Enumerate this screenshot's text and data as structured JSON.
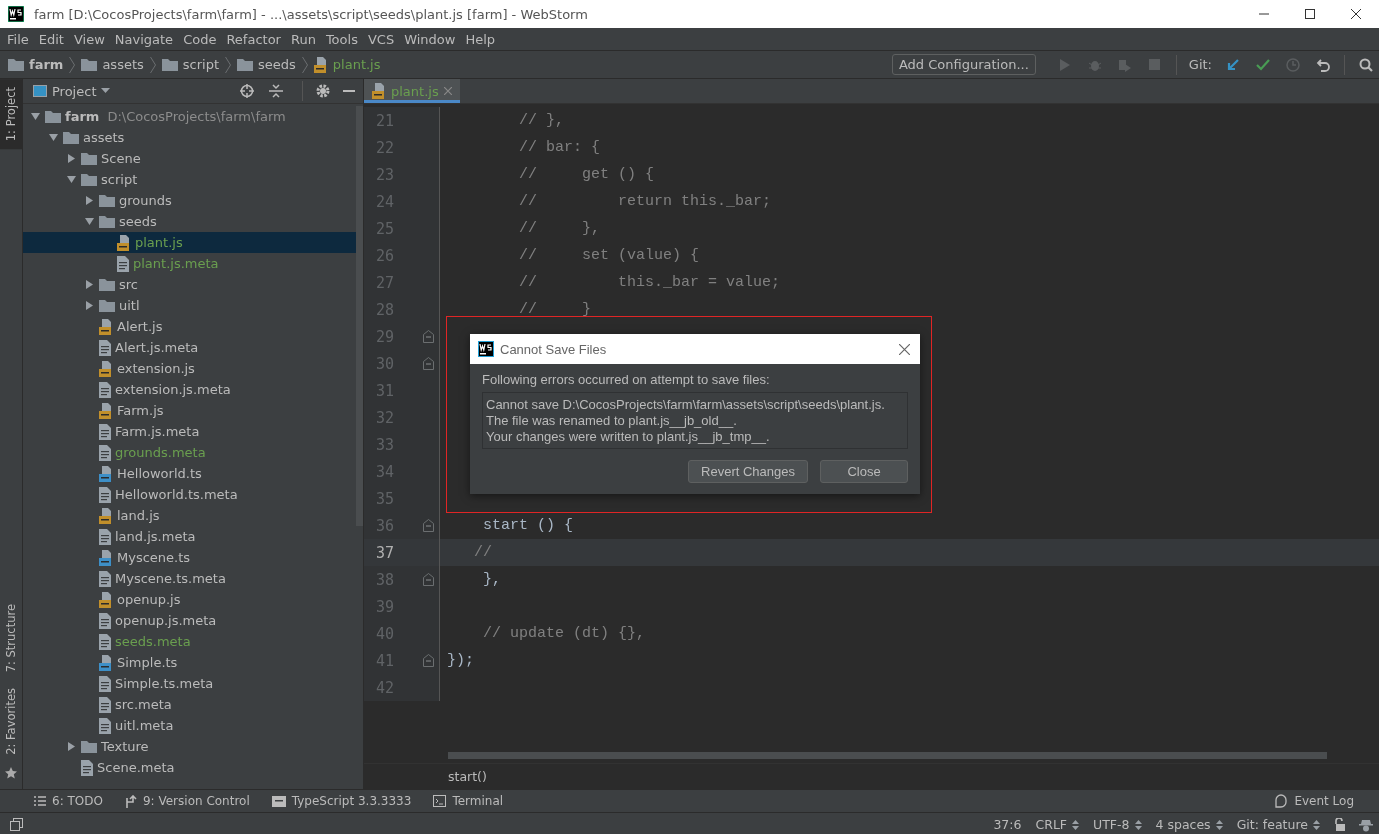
{
  "window": {
    "title": "farm [D:\\CocosProjects\\farm\\farm] - ...\\assets\\script\\seeds\\plant.js [farm] - WebStorm"
  },
  "menu": [
    "File",
    "Edit",
    "View",
    "Navigate",
    "Code",
    "Refactor",
    "Run",
    "Tools",
    "VCS",
    "Window",
    "Help"
  ],
  "breadcrumbs": [
    {
      "label": "farm",
      "kind": "root"
    },
    {
      "label": "assets",
      "kind": "folder"
    },
    {
      "label": "script",
      "kind": "folder"
    },
    {
      "label": "seeds",
      "kind": "folder"
    },
    {
      "label": "plant.js",
      "kind": "js"
    }
  ],
  "toolbar": {
    "configuration": "Add Configuration...",
    "vcs_label": "Git:"
  },
  "left_strip": [
    {
      "label": "1: Project",
      "selected": true
    },
    {
      "label": "7: Structure",
      "selected": false
    },
    {
      "label": "2: Favorites",
      "selected": false
    }
  ],
  "project": {
    "title": "Project",
    "tree": [
      {
        "name": "farm",
        "kind": "root",
        "path": "D:\\CocosProjects\\farm\\farm",
        "expanded": true,
        "selected": false,
        "modified": false,
        "children": [
          {
            "name": "assets",
            "kind": "folder",
            "expanded": true,
            "selected": false,
            "modified": false,
            "children": [
              {
                "name": "Scene",
                "kind": "folder",
                "expanded": false,
                "selected": false,
                "modified": false
              },
              {
                "name": "script",
                "kind": "folder",
                "expanded": true,
                "selected": false,
                "modified": false,
                "children": [
                  {
                    "name": "grounds",
                    "kind": "folder",
                    "expanded": false,
                    "selected": false,
                    "modified": false
                  },
                  {
                    "name": "seeds",
                    "kind": "folder",
                    "expanded": true,
                    "selected": false,
                    "modified": false,
                    "children": [
                      {
                        "name": "plant.js",
                        "kind": "js",
                        "selected": true,
                        "modified": true
                      },
                      {
                        "name": "plant.js.meta",
                        "kind": "meta",
                        "selected": false,
                        "modified": true
                      }
                    ]
                  },
                  {
                    "name": "src",
                    "kind": "folder",
                    "expanded": false,
                    "selected": false,
                    "modified": false
                  },
                  {
                    "name": "uitl",
                    "kind": "folder",
                    "expanded": false,
                    "selected": false,
                    "modified": false
                  },
                  {
                    "name": "Alert.js",
                    "kind": "js",
                    "selected": false,
                    "modified": false
                  },
                  {
                    "name": "Alert.js.meta",
                    "kind": "meta",
                    "selected": false,
                    "modified": false
                  },
                  {
                    "name": "extension.js",
                    "kind": "js",
                    "selected": false,
                    "modified": false
                  },
                  {
                    "name": "extension.js.meta",
                    "kind": "meta",
                    "selected": false,
                    "modified": false
                  },
                  {
                    "name": "Farm.js",
                    "kind": "js",
                    "selected": false,
                    "modified": false
                  },
                  {
                    "name": "Farm.js.meta",
                    "kind": "meta",
                    "selected": false,
                    "modified": false
                  },
                  {
                    "name": "grounds.meta",
                    "kind": "meta",
                    "selected": false,
                    "modified": true
                  },
                  {
                    "name": "Helloworld.ts",
                    "kind": "ts",
                    "selected": false,
                    "modified": false
                  },
                  {
                    "name": "Helloworld.ts.meta",
                    "kind": "meta",
                    "selected": false,
                    "modified": false
                  },
                  {
                    "name": "land.js",
                    "kind": "js",
                    "selected": false,
                    "modified": false
                  },
                  {
                    "name": "land.js.meta",
                    "kind": "meta",
                    "selected": false,
                    "modified": false
                  },
                  {
                    "name": "Myscene.ts",
                    "kind": "ts",
                    "selected": false,
                    "modified": false
                  },
                  {
                    "name": "Myscene.ts.meta",
                    "kind": "meta",
                    "selected": false,
                    "modified": false
                  },
                  {
                    "name": "openup.js",
                    "kind": "js",
                    "selected": false,
                    "modified": false
                  },
                  {
                    "name": "openup.js.meta",
                    "kind": "meta",
                    "selected": false,
                    "modified": false
                  },
                  {
                    "name": "seeds.meta",
                    "kind": "meta",
                    "selected": false,
                    "modified": true
                  },
                  {
                    "name": "Simple.ts",
                    "kind": "ts",
                    "selected": false,
                    "modified": false
                  },
                  {
                    "name": "Simple.ts.meta",
                    "kind": "meta",
                    "selected": false,
                    "modified": false
                  },
                  {
                    "name": "src.meta",
                    "kind": "meta",
                    "selected": false,
                    "modified": false
                  },
                  {
                    "name": "uitl.meta",
                    "kind": "meta",
                    "selected": false,
                    "modified": false
                  }
                ]
              },
              {
                "name": "Texture",
                "kind": "folder",
                "expanded": false,
                "selected": false,
                "modified": false
              },
              {
                "name": "Scene.meta",
                "kind": "meta",
                "selected": false,
                "modified": false
              }
            ]
          }
        ]
      }
    ]
  },
  "editor": {
    "tabs": [
      {
        "label": "plant.js",
        "kind": "js",
        "selected": true,
        "modified": true
      }
    ],
    "lines": [
      {
        "number": "21",
        "text": "        // },",
        "kind": "comment",
        "fold": false,
        "current": false
      },
      {
        "number": "22",
        "text": "        // bar: {",
        "kind": "comment",
        "fold": false,
        "current": false
      },
      {
        "number": "23",
        "text": "        //     get () {",
        "kind": "comment",
        "fold": false,
        "current": false
      },
      {
        "number": "24",
        "text": "        //         return this._bar;",
        "kind": "comment",
        "fold": false,
        "current": false
      },
      {
        "number": "25",
        "text": "        //     },",
        "kind": "comment",
        "fold": false,
        "current": false
      },
      {
        "number": "26",
        "text": "        //     set (value) {",
        "kind": "comment",
        "fold": false,
        "current": false
      },
      {
        "number": "27",
        "text": "        //         this._bar = value;",
        "kind": "comment",
        "fold": false,
        "current": false
      },
      {
        "number": "28",
        "text": "        //     }",
        "kind": "comment",
        "fold": false,
        "current": false
      },
      {
        "number": "29",
        "kind": "hidden",
        "fold": true,
        "current": false
      },
      {
        "number": "30",
        "kind": "hidden",
        "fold": true,
        "current": false
      },
      {
        "number": "31",
        "kind": "hidden",
        "fold": false,
        "current": false
      },
      {
        "number": "32",
        "kind": "hidden",
        "fold": false,
        "current": false
      },
      {
        "number": "33",
        "kind": "hidden",
        "fold": false,
        "current": false
      },
      {
        "number": "34",
        "kind": "hidden",
        "fold": false,
        "current": false
      },
      {
        "number": "35",
        "kind": "hidden",
        "fold": false,
        "current": false
      },
      {
        "number": "36",
        "text": "    start () {",
        "kind": "code",
        "fold": true,
        "current": false
      },
      {
        "number": "37",
        "text": "   //",
        "kind": "comment",
        "fold": false,
        "current": true
      },
      {
        "number": "38",
        "text": "    },",
        "kind": "code",
        "fold": true,
        "current": false
      },
      {
        "number": "39",
        "kind": "empty",
        "fold": false,
        "current": false
      },
      {
        "number": "40",
        "text": "    // update (dt) {},",
        "kind": "comment",
        "fold": false,
        "current": false
      },
      {
        "number": "41",
        "text": "});",
        "kind": "code",
        "fold": true,
        "current": false
      },
      {
        "number": "42",
        "kind": "empty",
        "fold": false,
        "current": false
      }
    ],
    "breadcrumb": "start()"
  },
  "dialog": {
    "title": "Cannot Save Files",
    "message": "Following errors occurred on attempt to save files:",
    "details": [
      "Cannot save D:\\CocosProjects\\farm\\farm\\assets\\script\\seeds\\plant.js.",
      "The file was renamed to plant.js__jb_old__.",
      "Your changes were written to plant.js__jb_tmp__."
    ],
    "buttons": [
      "Revert Changes",
      "Close"
    ]
  },
  "tool_windows": [
    {
      "label": "6: TODO",
      "kind": "list"
    },
    {
      "label": "9: Version Control",
      "kind": "vcs"
    },
    {
      "label": "TypeScript 3.3.3333",
      "kind": "ts"
    },
    {
      "label": "Terminal",
      "kind": "terminal"
    }
  ],
  "event_log": "Event Log",
  "status_bar": [
    {
      "label": "37:6",
      "kind": "text"
    },
    {
      "label": "CRLF",
      "kind": "select"
    },
    {
      "label": "UTF-8",
      "kind": "select"
    },
    {
      "label": "4 spaces",
      "kind": "select"
    },
    {
      "label": "Git: feature",
      "kind": "select"
    }
  ]
}
